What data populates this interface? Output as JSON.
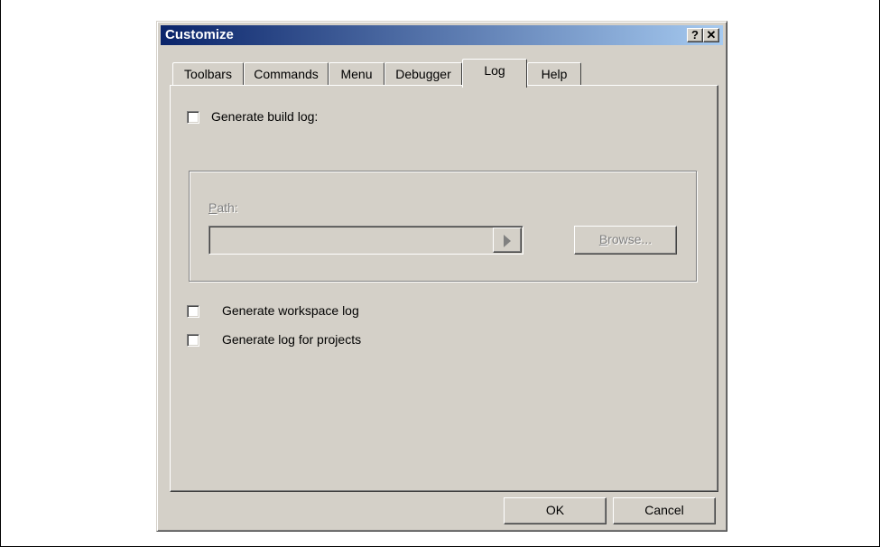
{
  "dialog": {
    "title": "Customize",
    "help_glyph": "?",
    "close_glyph": "✕"
  },
  "tabs": [
    {
      "label": "Toolbars",
      "active": false
    },
    {
      "label": "Commands",
      "active": false
    },
    {
      "label": "Menu",
      "active": false
    },
    {
      "label": "Debugger",
      "active": false
    },
    {
      "label": "Log",
      "active": true
    },
    {
      "label": "Help",
      "active": false
    }
  ],
  "log_tab": {
    "generate_build_log": {
      "label": "Generate build log:",
      "checked": false
    },
    "path_group": {
      "path_label_mnemonic": "P",
      "path_label_rest": "ath:",
      "path_value": "",
      "browse_mnemonic": "B",
      "browse_rest": "rowse..."
    },
    "generate_workspace_log": {
      "label": "Generate workspace log",
      "checked": false
    },
    "generate_log_for_projects": {
      "label": "Generate log for projects",
      "checked": false
    }
  },
  "buttons": {
    "ok_label": "OK",
    "cancel_label": "Cancel"
  },
  "colors": {
    "titlebar_start": "#0a246a",
    "titlebar_end": "#a6caf0",
    "face": "#d4d0c8"
  }
}
